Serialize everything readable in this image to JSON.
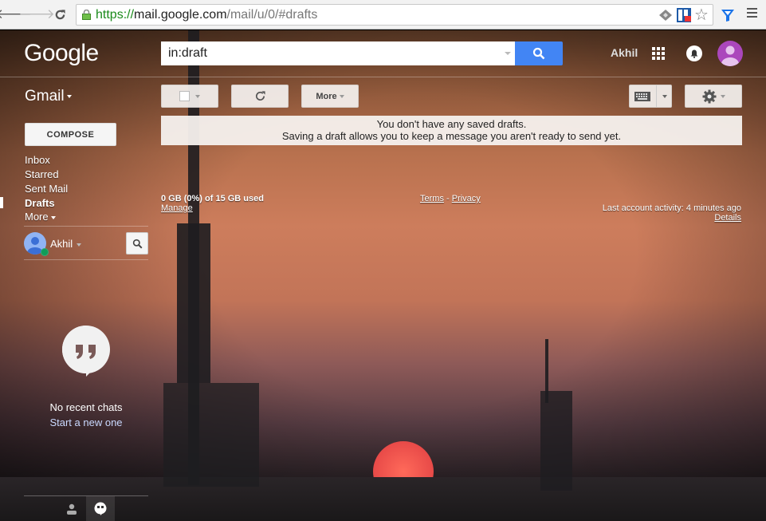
{
  "browser": {
    "url_scheme": "https://",
    "url_host": "mail.google.com",
    "url_path": "/mail/u/0/#drafts"
  },
  "header": {
    "logo": "Google",
    "search_value": "in:draft",
    "user_name": "Akhil"
  },
  "toolbar": {
    "app_label": "Gmail",
    "more_label": "More"
  },
  "sidebar": {
    "compose_label": "COMPOSE",
    "items": [
      {
        "label": "Inbox"
      },
      {
        "label": "Starred"
      },
      {
        "label": "Sent Mail"
      },
      {
        "label": "Drafts",
        "active": true
      },
      {
        "label": "More"
      }
    ],
    "hangouts_user": "Akhil",
    "no_chats": "No recent chats",
    "start_new": "Start a new one"
  },
  "main": {
    "empty_line1": "You don't have any saved drafts.",
    "empty_line2": "Saving a draft allows you to keep a message you aren't ready to send yet.",
    "storage": "0 GB (0%) of 15 GB used",
    "manage": "Manage",
    "terms": "Terms",
    "separator": " - ",
    "privacy": "Privacy",
    "last_activity": "Last account activity: 4 minutes ago",
    "details": "Details"
  },
  "colors": {
    "search_button": "#4285f4",
    "avatar": "#ab47bc",
    "online_status": "#0f9d58"
  }
}
